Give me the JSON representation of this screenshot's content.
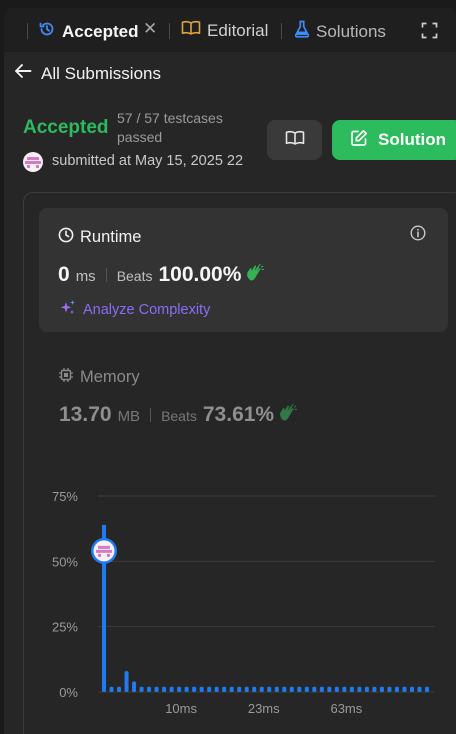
{
  "tabs": [
    {
      "label": "Accepted",
      "icon": "history-icon",
      "active": true
    },
    {
      "label": "Editorial",
      "icon": "book-icon"
    },
    {
      "label": "Solutions",
      "icon": "flask-icon"
    }
  ],
  "nav": {
    "back_label": "All Submissions"
  },
  "submission": {
    "status": "Accepted",
    "testcases": "57 / 57 testcases passed",
    "submitted": "submitted at May 15, 2025 22"
  },
  "actions": {
    "solution_label": "Solution"
  },
  "runtime": {
    "title": "Runtime",
    "value": "0",
    "unit": "ms",
    "beats_label": "Beats",
    "beats_value": "100.00%",
    "analyze_label": "Analyze Complexity"
  },
  "memory": {
    "title": "Memory",
    "value": "13.70",
    "unit": "MB",
    "beats_label": "Beats",
    "beats_value": "73.61%"
  },
  "colors": {
    "accepted": "#2cbb5d",
    "bar": "#1f7bf2",
    "analyze": "#8d6cf6"
  },
  "chart_data": {
    "type": "bar",
    "y_ticks": [
      "75%",
      "50%",
      "25%",
      "0%"
    ],
    "x_tick_labels": [
      "10ms",
      "23ms",
      "63ms"
    ],
    "ylim": [
      0,
      75
    ],
    "grid": true,
    "values": [
      64,
      2,
      2,
      8,
      4,
      2,
      2,
      2,
      2,
      2,
      2,
      2,
      2,
      2,
      2,
      2,
      2,
      2,
      2,
      2,
      2,
      2,
      2,
      2,
      2,
      2,
      2,
      2,
      2,
      2,
      2,
      2,
      2,
      2,
      2,
      2,
      2,
      2,
      2,
      2,
      2,
      2,
      2,
      2
    ],
    "highlight_index": 0,
    "highlight_value": 54
  }
}
